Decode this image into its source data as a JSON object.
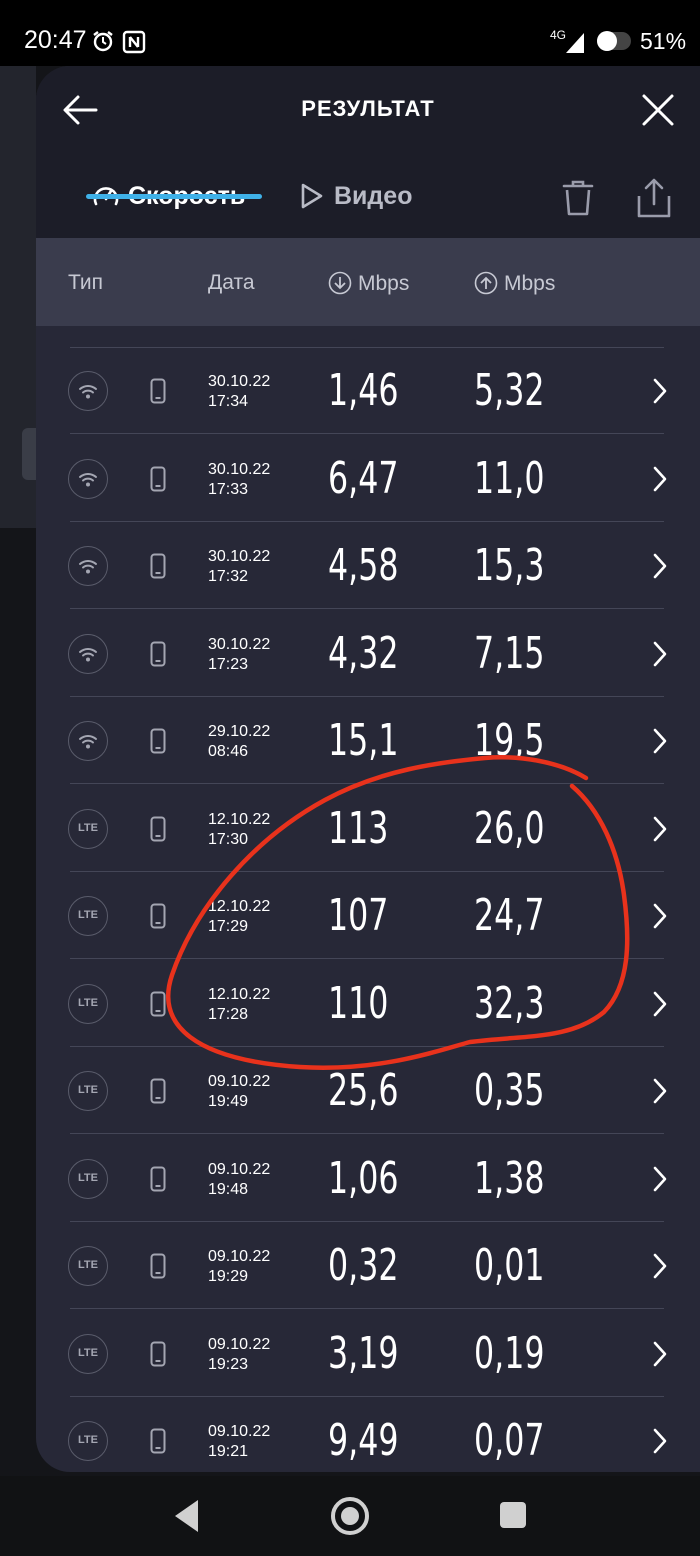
{
  "status_bar": {
    "time": "20:47",
    "network": "4G",
    "battery": "51%"
  },
  "header": {
    "title": "РЕЗУЛЬТАТ"
  },
  "tabs": {
    "speed_label": "Скорость",
    "video_label": "Видео",
    "active": "speed"
  },
  "columns": {
    "type": "Тип",
    "date": "Дата",
    "download_unit": "Mbps",
    "upload_unit": "Mbps"
  },
  "results": [
    {
      "type": "wifi",
      "date": "30.10.22",
      "time": "17:34",
      "download": "1,46",
      "upload": "5,32"
    },
    {
      "type": "wifi",
      "date": "30.10.22",
      "time": "17:33",
      "download": "6,47",
      "upload": "11,0"
    },
    {
      "type": "wifi",
      "date": "30.10.22",
      "time": "17:32",
      "download": "4,58",
      "upload": "15,3"
    },
    {
      "type": "wifi",
      "date": "30.10.22",
      "time": "17:23",
      "download": "4,32",
      "upload": "7,15"
    },
    {
      "type": "wifi",
      "date": "29.10.22",
      "time": "08:46",
      "download": "15,1",
      "upload": "19,5"
    },
    {
      "type": "lte",
      "type_label": "LTE",
      "date": "12.10.22",
      "time": "17:30",
      "download": "113",
      "upload": "26,0"
    },
    {
      "type": "lte",
      "type_label": "LTE",
      "date": "12.10.22",
      "time": "17:29",
      "download": "107",
      "upload": "24,7"
    },
    {
      "type": "lte",
      "type_label": "LTE",
      "date": "12.10.22",
      "time": "17:28",
      "download": "110",
      "upload": "32,3"
    },
    {
      "type": "lte",
      "type_label": "LTE",
      "date": "09.10.22",
      "time": "19:49",
      "download": "25,6",
      "upload": "0,35"
    },
    {
      "type": "lte",
      "type_label": "LTE",
      "date": "09.10.22",
      "time": "19:48",
      "download": "1,06",
      "upload": "1,38"
    },
    {
      "type": "lte",
      "type_label": "LTE",
      "date": "09.10.22",
      "time": "19:29",
      "download": "0,32",
      "upload": "0,01"
    },
    {
      "type": "lte",
      "type_label": "LTE",
      "date": "09.10.22",
      "time": "19:23",
      "download": "3,19",
      "upload": "0,19"
    },
    {
      "type": "lte",
      "type_label": "LTE",
      "date": "09.10.22",
      "time": "19:21",
      "download": "9,49",
      "upload": "0,07"
    }
  ],
  "colors": {
    "accent": "#3fb1e8",
    "panel": "#272837",
    "header": "#1c1d28",
    "column_header": "#3a3c4d",
    "annotation": "#e8321c"
  }
}
